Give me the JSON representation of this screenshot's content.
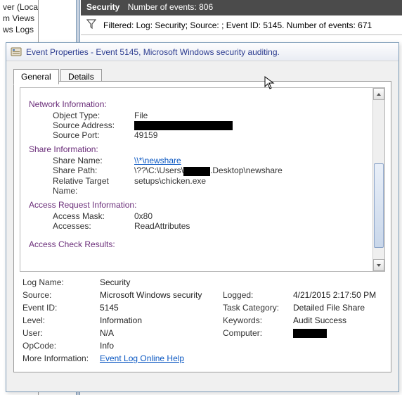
{
  "left_tree": {
    "item0": "ver (Local)",
    "item1": "m Views",
    "item2": "ws Logs"
  },
  "header": {
    "section": "Security",
    "events_label": "Number of events:",
    "events_count": "806"
  },
  "filter": {
    "text": "Filtered: Log: Security; Source: ; Event ID: 5145. Number of events: 671"
  },
  "dialog": {
    "title": "Event Properties - Event 5145, Microsoft Windows security auditing."
  },
  "tabs": {
    "general": "General",
    "details": "Details"
  },
  "details": {
    "network_head": "Network Information:",
    "object_type_k": "Object Type:",
    "object_type_v": "File",
    "source_addr_k": "Source Address:",
    "source_port_k": "Source Port:",
    "source_port_v": "49159",
    "share_head": "Share Information:",
    "share_name_k": "Share Name:",
    "share_name_v": "\\\\*\\newshare",
    "share_path_k": "Share Path:",
    "share_path_pre": "\\??\\C:\\Users\\",
    "share_path_post": ".Desktop\\newshare",
    "rel_target_k": "Relative Target Name:",
    "rel_target_v": "setups\\chicken.exe",
    "access_req_head": "Access Request Information:",
    "access_mask_k": "Access Mask:",
    "access_mask_v": "0x80",
    "accesses_k": "Accesses:",
    "accesses_v": "ReadAttributes",
    "access_check_head": "Access Check Results:"
  },
  "meta": {
    "logname_k": "Log Name:",
    "logname_v": "Security",
    "source_k": "Source:",
    "source_v": "Microsoft Windows security",
    "logged_k": "Logged:",
    "logged_v": "4/21/2015 2:17:50 PM",
    "eventid_k": "Event ID:",
    "eventid_v": "5145",
    "taskcat_k": "Task Category:",
    "taskcat_v": "Detailed File Share",
    "level_k": "Level:",
    "level_v": "Information",
    "keywords_k": "Keywords:",
    "keywords_v": "Audit Success",
    "user_k": "User:",
    "user_v": "N/A",
    "computer_k": "Computer:",
    "opcode_k": "OpCode:",
    "opcode_v": "Info",
    "moreinfo_k": "More Information:",
    "moreinfo_link": "Event Log Online Help"
  }
}
